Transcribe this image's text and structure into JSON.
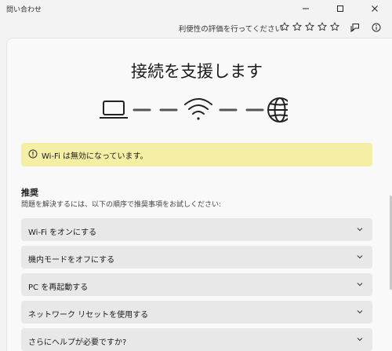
{
  "window": {
    "title": "問い合わせ"
  },
  "toolbar": {
    "feedback_label": "利便性の評価を行ってください",
    "star_count": 5
  },
  "main": {
    "heading": "接続を支援します",
    "alert": {
      "text": "Wi-Fi は無効になっています。",
      "color": "#f5efa5"
    },
    "recommendations": {
      "title": "推奨",
      "description": "問題を解決するには、以下の順序で推奨事項をお試しください:",
      "items": [
        {
          "label": "Wi-Fi をオンにする"
        },
        {
          "label": "機内モードをオフにする"
        },
        {
          "label": "PC を再起動する"
        },
        {
          "label": "ネットワーク リセットを使用する"
        },
        {
          "label": "さらにヘルプが必要ですか?"
        }
      ]
    }
  },
  "icons": [
    "minimize-icon",
    "maximize-icon",
    "close-icon",
    "star-icon",
    "feedback-icon",
    "info-icon",
    "laptop-icon",
    "wifi-icon",
    "globe-icon",
    "warning-icon",
    "chevron-down-icon"
  ]
}
